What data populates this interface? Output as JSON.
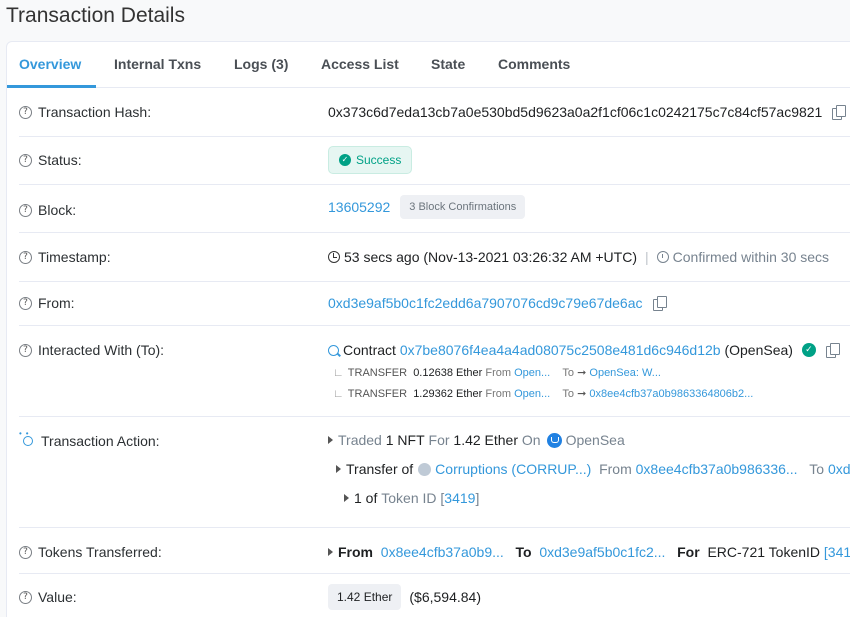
{
  "page": {
    "title": "Transaction Details"
  },
  "tabs": [
    {
      "label": "Overview"
    },
    {
      "label": "Internal Txns"
    },
    {
      "label": "Logs (3)"
    },
    {
      "label": "Access List"
    },
    {
      "label": "State"
    },
    {
      "label": "Comments"
    }
  ],
  "hash": {
    "label": "Transaction Hash:",
    "value": "0x373c6d7eda13cb7a0e530bd5d9623a0a2f1cf06c1c0242175c7c84cf57ac9821"
  },
  "status": {
    "label": "Status:",
    "value": "Success"
  },
  "block": {
    "label": "Block:",
    "number": "13605292",
    "confirmations": "3 Block Confirmations"
  },
  "timestamp": {
    "label": "Timestamp:",
    "value": "53 secs ago (Nov-13-2021 03:26:32 AM +UTC)",
    "separator": "|",
    "confirmed": "Confirmed within 30 secs"
  },
  "from": {
    "label": "From:",
    "address": "0xd3e9af5b0c1fc2edd6a7907076cd9c79e67de6ac"
  },
  "interacted": {
    "label": "Interacted With (To):",
    "prefix": "Contract",
    "address": "0x7be8076f4ea4a4ad08075c2508e481d6c946d12b",
    "name": "(OpenSea)",
    "transfers": [
      {
        "corner": "∟",
        "type": "TRANSFER",
        "amount": "0.12638 Ether",
        "from_label": "From",
        "from": "Open...",
        "to_label": "To",
        "arrow": "➞",
        "to": "OpenSea: W..."
      },
      {
        "corner": "∟",
        "type": "TRANSFER",
        "amount": "1.29362 Ether",
        "from_label": "From",
        "from": "Open...",
        "to_label": "To",
        "arrow": "➞",
        "to": "0x8ee4cfb37a0b9863364806b2..."
      }
    ]
  },
  "action": {
    "label": "Transaction Action:",
    "line1": {
      "w1": "Traded",
      "w2": "1 NFT",
      "w3": "For",
      "w4": "1.42 Ether",
      "w5": "On",
      "w6": "OpenSea"
    },
    "line2": {
      "w1": "Transfer of",
      "token": "Corruptions (CORRUP...)",
      "w2": "From",
      "from": "0x8ee4cfb37a0b986336...",
      "w3": "To",
      "to": "0xd"
    },
    "line3": {
      "w1": "1 of",
      "w2": "Token ID",
      "open": "[",
      "id": "3419",
      "close": "]"
    }
  },
  "tokens": {
    "label": "Tokens Transferred:",
    "from_label": "From",
    "from": "0x8ee4cfb37a0b9...",
    "to_label": "To",
    "to": "0xd3e9af5b0c1fc2...",
    "for_label": "For",
    "standard": "ERC-721 TokenID",
    "token_id": "[341"
  },
  "value": {
    "label": "Value:",
    "amount": "1.42 Ether",
    "usd": "($6,594.84)"
  },
  "icons": {
    "question": "?",
    "check": "✓"
  },
  "colors": {
    "link": "#3498db",
    "success": "#00a186",
    "border": "#e7eaf3"
  }
}
